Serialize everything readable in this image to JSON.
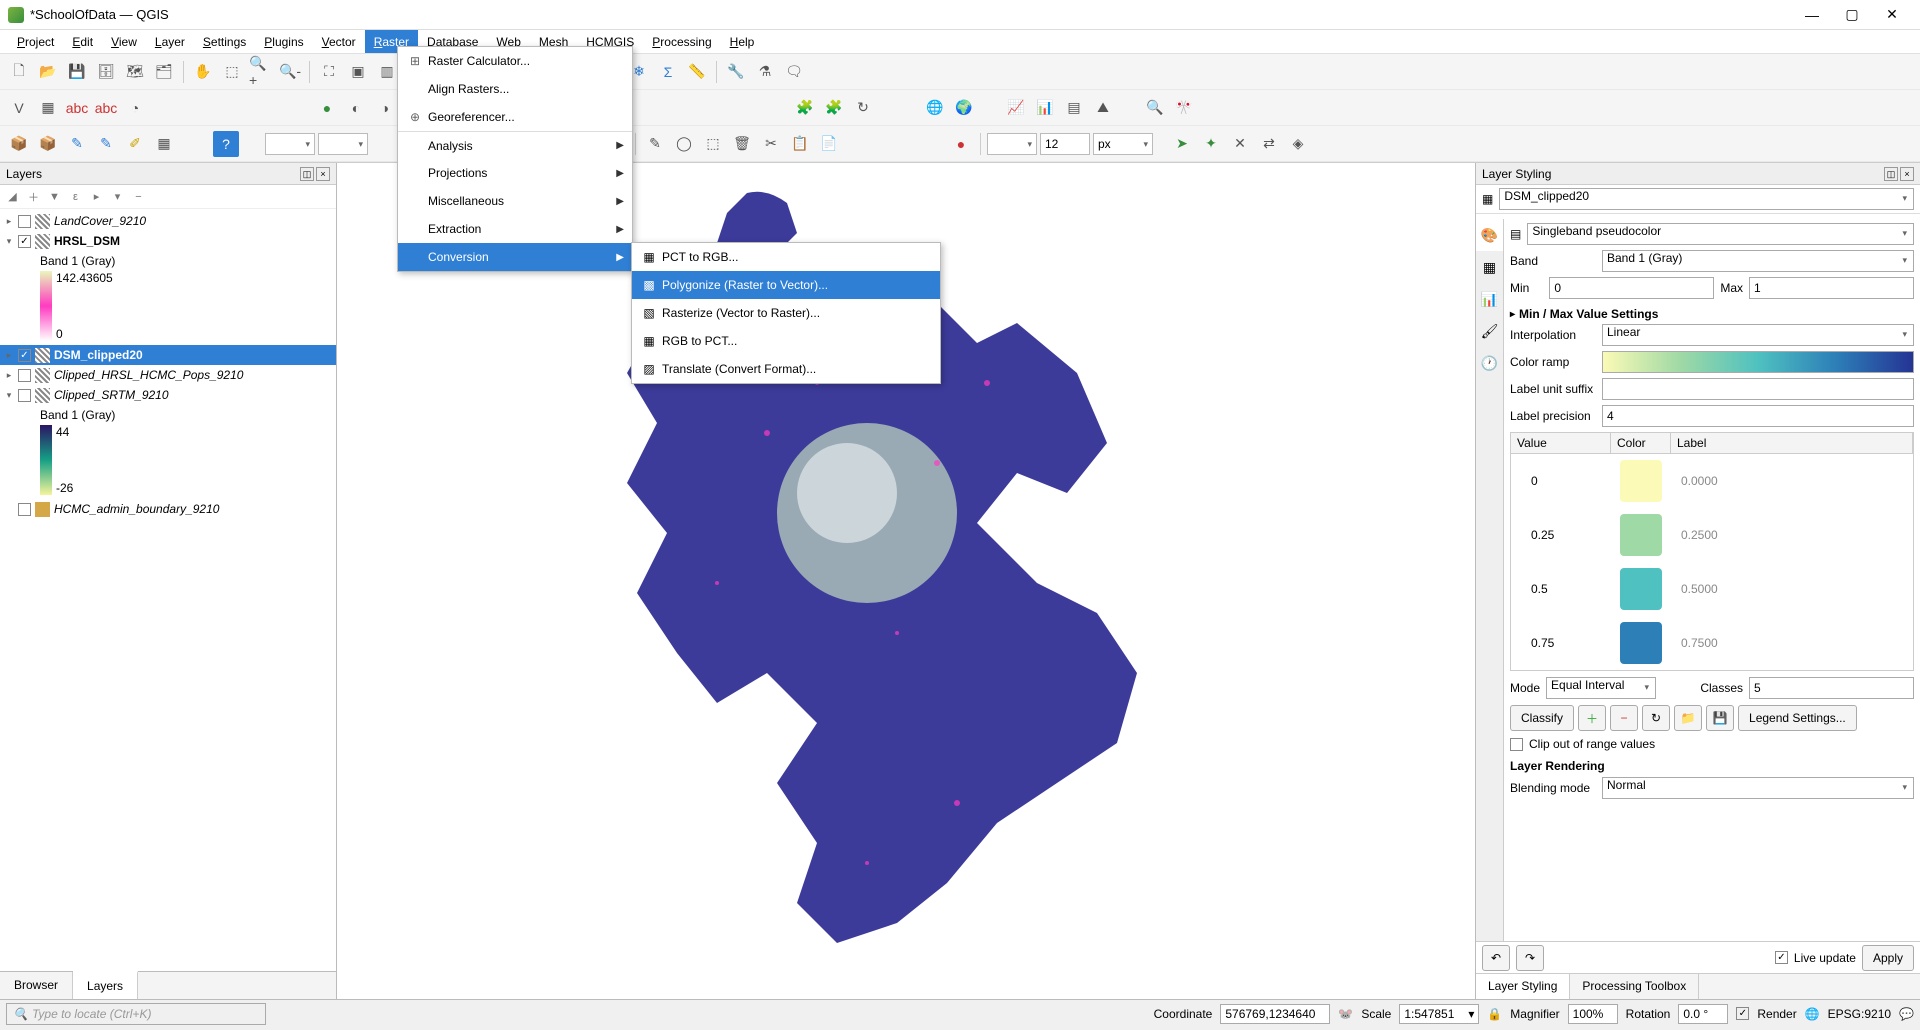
{
  "title": "*SchoolOfData — QGIS",
  "menu": {
    "items": [
      "Project",
      "Edit",
      "View",
      "Layer",
      "Settings",
      "Plugins",
      "Vector",
      "Raster",
      "Database",
      "Web",
      "Mesh",
      "HCMGIS",
      "Processing",
      "Help"
    ],
    "active_index": 7
  },
  "raster_dropdown": {
    "items": [
      {
        "label": "Raster Calculator...",
        "icon": "⊞"
      },
      {
        "label": "Align Rasters...",
        "icon": ""
      },
      {
        "label": "Georeferencer...",
        "icon": "⊕"
      },
      {
        "label": "Analysis",
        "arrow": true
      },
      {
        "label": "Projections",
        "arrow": true
      },
      {
        "label": "Miscellaneous",
        "arrow": true
      },
      {
        "label": "Extraction",
        "arrow": true
      },
      {
        "label": "Conversion",
        "arrow": true,
        "hl": true
      }
    ]
  },
  "conversion_submenu": {
    "items": [
      {
        "label": "PCT to RGB...",
        "icon": "▦"
      },
      {
        "label": "Polygonize (Raster to Vector)...",
        "icon": "▩",
        "hl": true
      },
      {
        "label": "Rasterize (Vector to Raster)...",
        "icon": "▧"
      },
      {
        "label": "RGB to PCT...",
        "icon": "▦"
      },
      {
        "label": "Translate (Convert Format)...",
        "icon": "▨"
      }
    ]
  },
  "toolbar3": {
    "num": "12",
    "unit": "px"
  },
  "layers_panel": {
    "title": "Layers",
    "tree": [
      {
        "type": "layer",
        "name": "LandCover_9210",
        "checked": false,
        "exp": "▸",
        "italic": true
      },
      {
        "type": "layer",
        "name": "HRSL_DSM",
        "checked": true,
        "exp": "▾",
        "bold": true
      },
      {
        "type": "band",
        "label": "Band 1 (Gray)"
      },
      {
        "type": "ramp",
        "colors": [
          "#e9f7bb",
          "#ff3bc0",
          "#ffffff"
        ],
        "top": "142.43605",
        "bot": "0"
      },
      {
        "type": "layer",
        "name": "DSM_clipped20",
        "checked": true,
        "exp": "▸",
        "bold": true,
        "sel": true
      },
      {
        "type": "layer",
        "name": "Clipped_HRSL_HCMC_Pops_9210",
        "checked": false,
        "exp": "▸",
        "italic": true
      },
      {
        "type": "layer",
        "name": "Clipped_SRTM_9210",
        "checked": false,
        "exp": "▾",
        "italic": true
      },
      {
        "type": "band",
        "label": "Band 1 (Gray)"
      },
      {
        "type": "ramp",
        "colors": [
          "#2b1464",
          "#16a085",
          "#f5f59a"
        ],
        "top": "44",
        "bot": "-26"
      },
      {
        "type": "layer",
        "name": "HCMC_admin_boundary_9210",
        "checked": false,
        "exp": "",
        "italic": true,
        "poly": true
      }
    ]
  },
  "bottom_left_tabs": [
    "Browser",
    "Layers"
  ],
  "styling": {
    "title": "Layer Styling",
    "layer": "DSM_clipped20",
    "renderer": "Singleband pseudocolor",
    "band_label": "Band",
    "band": "Band 1 (Gray)",
    "min_label": "Min",
    "min": "0",
    "max_label": "Max",
    "max": "1",
    "minmax": "Min / Max Value Settings",
    "interp_label": "Interpolation",
    "interp": "Linear",
    "ramp_label": "Color ramp",
    "suffix_label": "Label unit suffix",
    "suffix": "",
    "prec_label": "Label precision",
    "prec": "4",
    "table_hdr": [
      "Value",
      "Color",
      "Label"
    ],
    "rows": [
      {
        "v": "0",
        "c": "#fbfab6",
        "l": "0.0000"
      },
      {
        "v": "0.25",
        "c": "#9fd9a5",
        "l": "0.2500"
      },
      {
        "v": "0.5",
        "c": "#4fc1c0",
        "l": "0.5000"
      },
      {
        "v": "0.75",
        "c": "#2d7fb8",
        "l": "0.7500"
      }
    ],
    "mode_label": "Mode",
    "mode": "Equal Interval",
    "classes_label": "Classes",
    "classes": "5",
    "classify": "Classify",
    "legend": "Legend Settings...",
    "clip": "Clip out of range values",
    "rendering": "Layer Rendering",
    "blend_label": "Blending mode",
    "blend": "Normal",
    "live": "Live update",
    "apply": "Apply"
  },
  "right_tabs": [
    "Layer Styling",
    "Processing Toolbox"
  ],
  "status": {
    "locator": "Type to locate (Ctrl+K)",
    "coord_label": "Coordinate",
    "coord": "576769,1234640",
    "scale_label": "Scale",
    "scale": "1:547851",
    "mag_label": "Magnifier",
    "mag": "100%",
    "rot_label": "Rotation",
    "rot": "0.0 °",
    "render": "Render",
    "crs": "EPSG:9210"
  }
}
